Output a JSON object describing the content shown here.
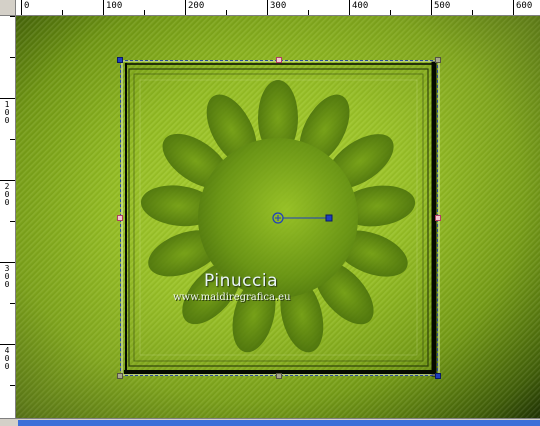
{
  "rulers": {
    "horizontal_labels": [
      "0",
      "100",
      "200",
      "300",
      "400",
      "500",
      "600"
    ],
    "vertical_labels": [
      "1\n0\n0",
      "2\n0\n0",
      "3\n0\n0",
      "4\n0\n0"
    ]
  },
  "canvas": {
    "watermark_title": "Pinuccia",
    "watermark_url": "www.maidiregrafica.eu"
  },
  "colors": {
    "background_light": "#a5cc2c",
    "background_dark": "#0f1d02",
    "selection_handle": "#1f3fbf",
    "scrollbar_thumb": "#3c6fd8"
  },
  "icons": {
    "center_pivot": "crosshair-circle-icon"
  }
}
